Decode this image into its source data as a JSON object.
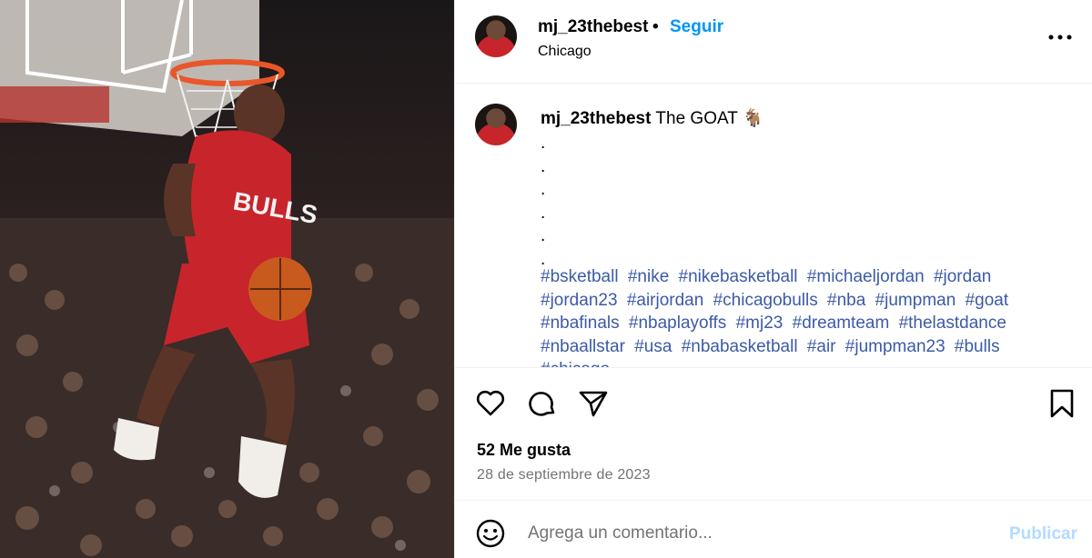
{
  "post": {
    "image_alt": "Basketball player in red Bulls 23 jersey dunking"
  },
  "header": {
    "username": "mj_23thebest",
    "separator": "•",
    "follow_label": "Seguir",
    "location": "Chicago"
  },
  "caption": {
    "username": "mj_23thebest",
    "text": "The GOAT 🐐",
    "dots": [
      ".",
      ".",
      ".",
      ".",
      ".",
      "."
    ],
    "hashtags": [
      "#bsketball",
      "#nike",
      "#nikebasketball",
      "#michaeljordan",
      "#jordan",
      "#jordan23",
      "#airjordan",
      "#chicagobulls",
      "#nba",
      "#jumpman",
      "#goat",
      "#nbafinals",
      "#nbaplayoffs",
      "#mj23",
      "#dreamteam",
      "#thelastdance",
      "#nbaallstar",
      "#usa",
      "#nbabasketball",
      "#air",
      "#jumpman23",
      "#bulls",
      "#chicago"
    ]
  },
  "actions": {
    "likes": "52 Me gusta",
    "date": "28 de septiembre de 2023"
  },
  "comment": {
    "placeholder": "Agrega un comentario...",
    "publish_label": "Publicar"
  },
  "colors": {
    "accent": "#0095f6",
    "hashtag": "#3c5aa7",
    "muted": "#737373",
    "publish_disabled": "#b3dbff",
    "jersey": "#c8242b"
  }
}
